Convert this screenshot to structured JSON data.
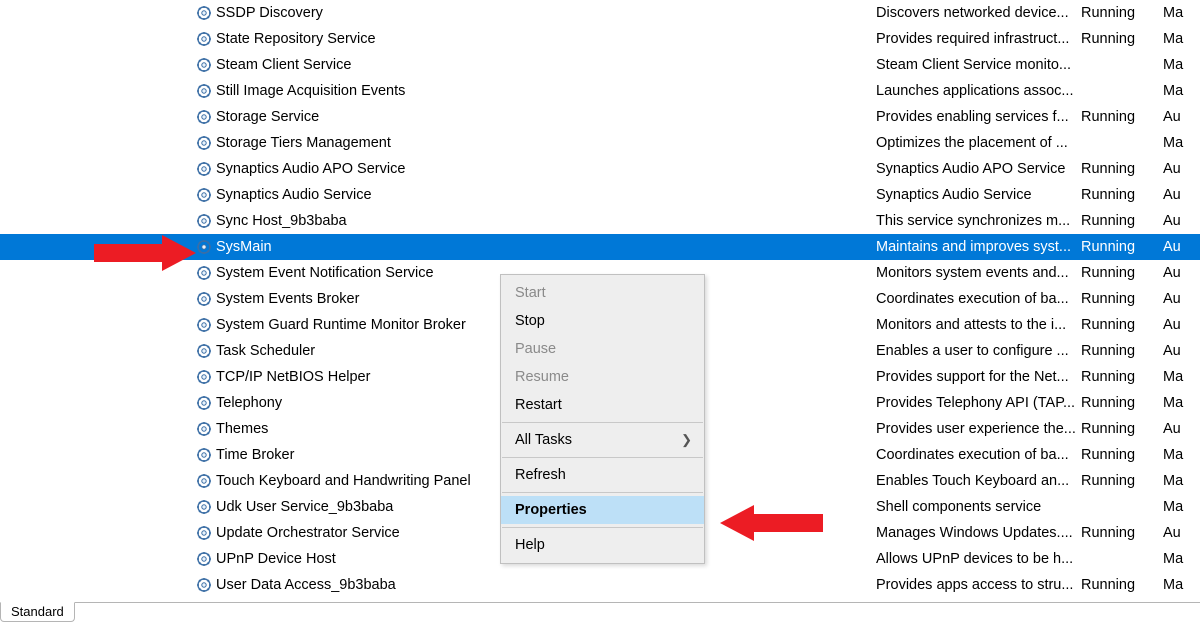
{
  "rows": [
    {
      "name": "SSDP Discovery",
      "desc": "Discovers networked device...",
      "status": "Running",
      "startup": "Ma",
      "selected": false
    },
    {
      "name": "State Repository Service",
      "desc": "Provides required infrastruct...",
      "status": "Running",
      "startup": "Ma",
      "selected": false
    },
    {
      "name": "Steam Client Service",
      "desc": "Steam Client Service monito...",
      "status": "",
      "startup": "Ma",
      "selected": false
    },
    {
      "name": "Still Image Acquisition Events",
      "desc": "Launches applications assoc...",
      "status": "",
      "startup": "Ma",
      "selected": false
    },
    {
      "name": "Storage Service",
      "desc": "Provides enabling services f...",
      "status": "Running",
      "startup": "Au",
      "selected": false
    },
    {
      "name": "Storage Tiers Management",
      "desc": "Optimizes the placement of ...",
      "status": "",
      "startup": "Ma",
      "selected": false
    },
    {
      "name": "Synaptics Audio APO Service",
      "desc": "Synaptics Audio APO Service",
      "status": "Running",
      "startup": "Au",
      "selected": false
    },
    {
      "name": "Synaptics Audio Service",
      "desc": "Synaptics Audio Service",
      "status": "Running",
      "startup": "Au",
      "selected": false
    },
    {
      "name": "Sync Host_9b3baba",
      "desc": "This service synchronizes m...",
      "status": "Running",
      "startup": "Au",
      "selected": false
    },
    {
      "name": "SysMain",
      "desc": "Maintains and improves syst...",
      "status": "Running",
      "startup": "Au",
      "selected": true
    },
    {
      "name": "System Event Notification Service",
      "desc": "Monitors system events and...",
      "status": "Running",
      "startup": "Au",
      "selected": false
    },
    {
      "name": "System Events Broker",
      "desc": "Coordinates execution of ba...",
      "status": "Running",
      "startup": "Au",
      "selected": false
    },
    {
      "name": "System Guard Runtime Monitor Broker",
      "desc": "Monitors and attests to the i...",
      "status": "Running",
      "startup": "Au",
      "selected": false
    },
    {
      "name": "Task Scheduler",
      "desc": "Enables a user to configure ...",
      "status": "Running",
      "startup": "Au",
      "selected": false
    },
    {
      "name": "TCP/IP NetBIOS Helper",
      "desc": "Provides support for the Net...",
      "status": "Running",
      "startup": "Ma",
      "selected": false
    },
    {
      "name": "Telephony",
      "desc": "Provides Telephony API (TAP...",
      "status": "Running",
      "startup": "Ma",
      "selected": false
    },
    {
      "name": "Themes",
      "desc": "Provides user experience the...",
      "status": "Running",
      "startup": "Au",
      "selected": false
    },
    {
      "name": "Time Broker",
      "desc": "Coordinates execution of ba...",
      "status": "Running",
      "startup": "Ma",
      "selected": false
    },
    {
      "name": "Touch Keyboard and Handwriting Panel",
      "desc": "Enables Touch Keyboard an...",
      "status": "Running",
      "startup": "Ma",
      "selected": false
    },
    {
      "name": "Udk User Service_9b3baba",
      "desc": "Shell components service",
      "status": "",
      "startup": "Ma",
      "selected": false
    },
    {
      "name": "Update Orchestrator Service",
      "desc": "Manages Windows Updates....",
      "status": "Running",
      "startup": "Au",
      "selected": false
    },
    {
      "name": "UPnP Device Host",
      "desc": "Allows UPnP devices to be h...",
      "status": "",
      "startup": "Ma",
      "selected": false
    },
    {
      "name": "User Data Access_9b3baba",
      "desc": "Provides apps access to stru...",
      "status": "Running",
      "startup": "Ma",
      "selected": false
    }
  ],
  "context_menu": {
    "start": "Start",
    "stop": "Stop",
    "pause": "Pause",
    "resume": "Resume",
    "restart": "Restart",
    "all_tasks": "All Tasks",
    "refresh": "Refresh",
    "properties": "Properties",
    "help": "Help"
  },
  "tab": {
    "standard": "Standard"
  }
}
